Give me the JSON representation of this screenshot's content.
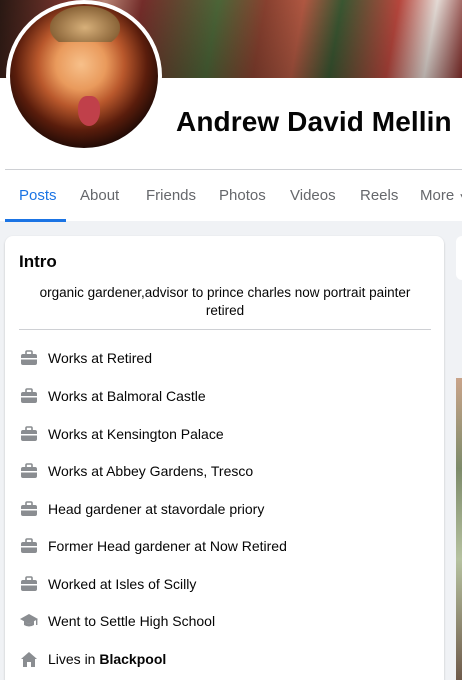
{
  "profile": {
    "name": "Andrew David Mellin"
  },
  "tabs": [
    {
      "label": "Posts",
      "active": true
    },
    {
      "label": "About",
      "active": false
    },
    {
      "label": "Friends",
      "active": false
    },
    {
      "label": "Photos",
      "active": false
    },
    {
      "label": "Videos",
      "active": false
    },
    {
      "label": "Reels",
      "active": false
    },
    {
      "label": "More",
      "active": false
    }
  ],
  "intro": {
    "title": "Intro",
    "bio": "organic gardener,advisor to prince charles now portrait painter retired",
    "items": [
      {
        "icon": "briefcase-icon",
        "text": "Works at Retired"
      },
      {
        "icon": "briefcase-icon",
        "text": "Works at Balmoral Castle"
      },
      {
        "icon": "briefcase-icon",
        "text": "Works at Kensington Palace"
      },
      {
        "icon": "briefcase-icon",
        "text": "Works at Abbey Gardens, Tresco"
      },
      {
        "icon": "briefcase-icon",
        "text": "Head gardener at stavordale priory"
      },
      {
        "icon": "briefcase-icon",
        "text": "Former Head gardener at Now Retired"
      },
      {
        "icon": "briefcase-icon",
        "text": "Worked at Isles of Scilly"
      },
      {
        "icon": "graduation-cap-icon",
        "text": "Went to Settle High School"
      },
      {
        "icon": "home-icon",
        "text_prefix": "Lives in ",
        "text_bold": "Blackpool"
      }
    ]
  },
  "colors": {
    "accent": "#1b74e4",
    "icon_gray": "#8a8d91",
    "text_secondary": "#65676b"
  }
}
